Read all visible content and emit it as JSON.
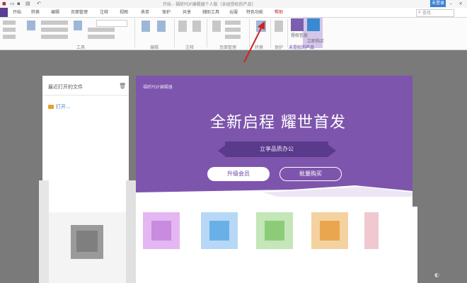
{
  "title_bar": {
    "title": "开始 - 福昕PDF编辑器个人版（未经授权的产品）",
    "login_label": "未登录"
  },
  "tabs": [
    "开始",
    "转换",
    "编辑",
    "页面管理",
    "注释",
    "视图",
    "表单",
    "保护",
    "共享",
    "辅助工具",
    "云服",
    "特色功能",
    "帮助"
  ],
  "search": {
    "placeholder": "查找"
  },
  "ribbon": {
    "groups": [
      "工具",
      "编辑",
      "注释",
      "页面管理",
      "转换",
      "保护"
    ],
    "buy_label": "授权信息",
    "wb_label": "立即购买",
    "highlight_label": "未授权的产品"
  },
  "recent": {
    "title": "最近打开的文件",
    "open_label": "打开..."
  },
  "banner": {
    "logo": "福昕PDF编辑器",
    "headline": "全新启程  耀世首发",
    "tagline": "立享品质办公",
    "upgrade_label": "升级会员",
    "bulk_label": "批量购买"
  },
  "colors": {
    "brand_purple": "#7e55ad",
    "band_purple": "#5a3a8a",
    "accent_blue": "#3b7fd3",
    "arrow_red": "#d22222"
  },
  "icons": {
    "trash": "trash-icon",
    "folder": "folder-icon",
    "search": "search-icon"
  }
}
